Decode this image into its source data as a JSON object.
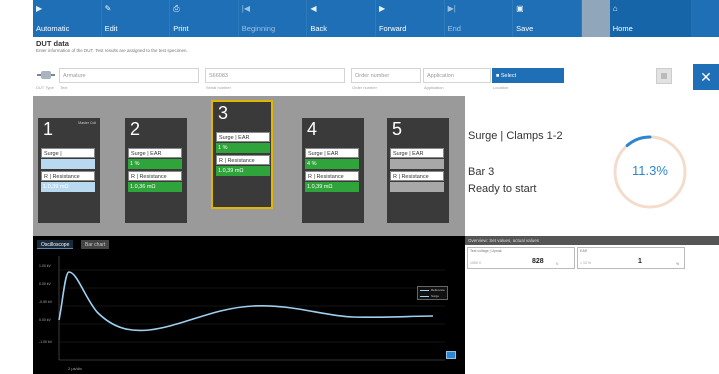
{
  "toolbar": {
    "buttons": [
      {
        "label": "Automatic",
        "icon": "play-icon",
        "glyph": "▶",
        "disabled": false
      },
      {
        "label": "Edit",
        "icon": "wrench-icon",
        "glyph": "✎",
        "disabled": false
      },
      {
        "label": "Print",
        "icon": "print-icon",
        "glyph": "⎙",
        "disabled": false
      },
      {
        "label": "Beginning",
        "icon": "skip-start-icon",
        "glyph": "|◀",
        "disabled": true
      },
      {
        "label": "Back",
        "icon": "back-icon",
        "glyph": "◀",
        "disabled": false
      },
      {
        "label": "Forward",
        "icon": "forward-icon",
        "glyph": "▶",
        "disabled": false
      },
      {
        "label": "End",
        "icon": "skip-end-icon",
        "glyph": "▶|",
        "disabled": true
      },
      {
        "label": "Save",
        "icon": "save-icon",
        "glyph": "▣",
        "disabled": false
      }
    ],
    "home": {
      "label": "Home",
      "icon": "home-icon",
      "glyph": "⌂"
    }
  },
  "dut": {
    "title": "DUT data",
    "subtitle": "Enter information of the DUT. Test results are assigned to the test specimen.",
    "fields": [
      {
        "value": "Armature",
        "caption": "Text"
      },
      {
        "value": "S66083",
        "caption": "Serial number"
      },
      {
        "value": "Order number",
        "caption": "Order number"
      },
      {
        "value": "Application",
        "caption": "Application"
      },
      {
        "value": "■ Select",
        "caption": "Location"
      }
    ],
    "type_caption": "DUT Type",
    "close_glyph": "✕"
  },
  "channels": [
    {
      "num": "1",
      "tag": "Master Coil",
      "r1": "Surge |",
      "r2": "",
      "r3": "R | Resistance",
      "r4": "1.0,39 mΩ",
      "s2": "lblue",
      "s4": "lblue"
    },
    {
      "num": "2",
      "tag": "",
      "r1": "Surge | EAR",
      "r2": "1 %",
      "r3": "R | Resistance",
      "r4": "1.0,36 mΩ",
      "s2": "green",
      "s4": "green"
    },
    {
      "num": "3",
      "tag": "",
      "r1": "Surge | EAR",
      "r2": "1 %",
      "r3": "R | Resistance",
      "r4": "1.0,39 mΩ",
      "s2": "green",
      "s4": "green"
    },
    {
      "num": "4",
      "tag": "",
      "r1": "Surge | EAR",
      "r2": "4 %",
      "r3": "R | Resistance",
      "r4": "1.0,39 mΩ",
      "s2": "green",
      "s4": "green"
    },
    {
      "num": "5",
      "tag": "",
      "r1": "Surge | EAR",
      "r2": "",
      "r3": "R | Resistance",
      "r4": "",
      "s2": "grey",
      "s4": "grey"
    }
  ],
  "status": {
    "title": "Surge | Clamps 1-2",
    "bar": "Bar 3",
    "state": "Ready to start",
    "progress_text": "11.3%",
    "progress": 0.113,
    "accent": "#2e86d0",
    "track": "#f4dccd"
  },
  "scope": {
    "tabs": [
      "Oscilloscope",
      "Bar chart"
    ],
    "yticks": [
      "1.00 kV",
      "0.00 kV",
      "-0.50 kV",
      "0.00 kV",
      "-1.00 kV"
    ],
    "xlabel": "2 µs/div",
    "legend": [
      "Reference",
      "Surge"
    ],
    "trace_color": "#9fd0f0"
  },
  "values": {
    "header": "Overview: Set values, actual values",
    "cells": [
      {
        "label": "Test voltage | Upeak",
        "sub": "1000 V",
        "value": "828",
        "unit": "V"
      },
      {
        "label": "EAR",
        "sub": "< 10 %",
        "value": "1",
        "unit": "%"
      }
    ]
  }
}
